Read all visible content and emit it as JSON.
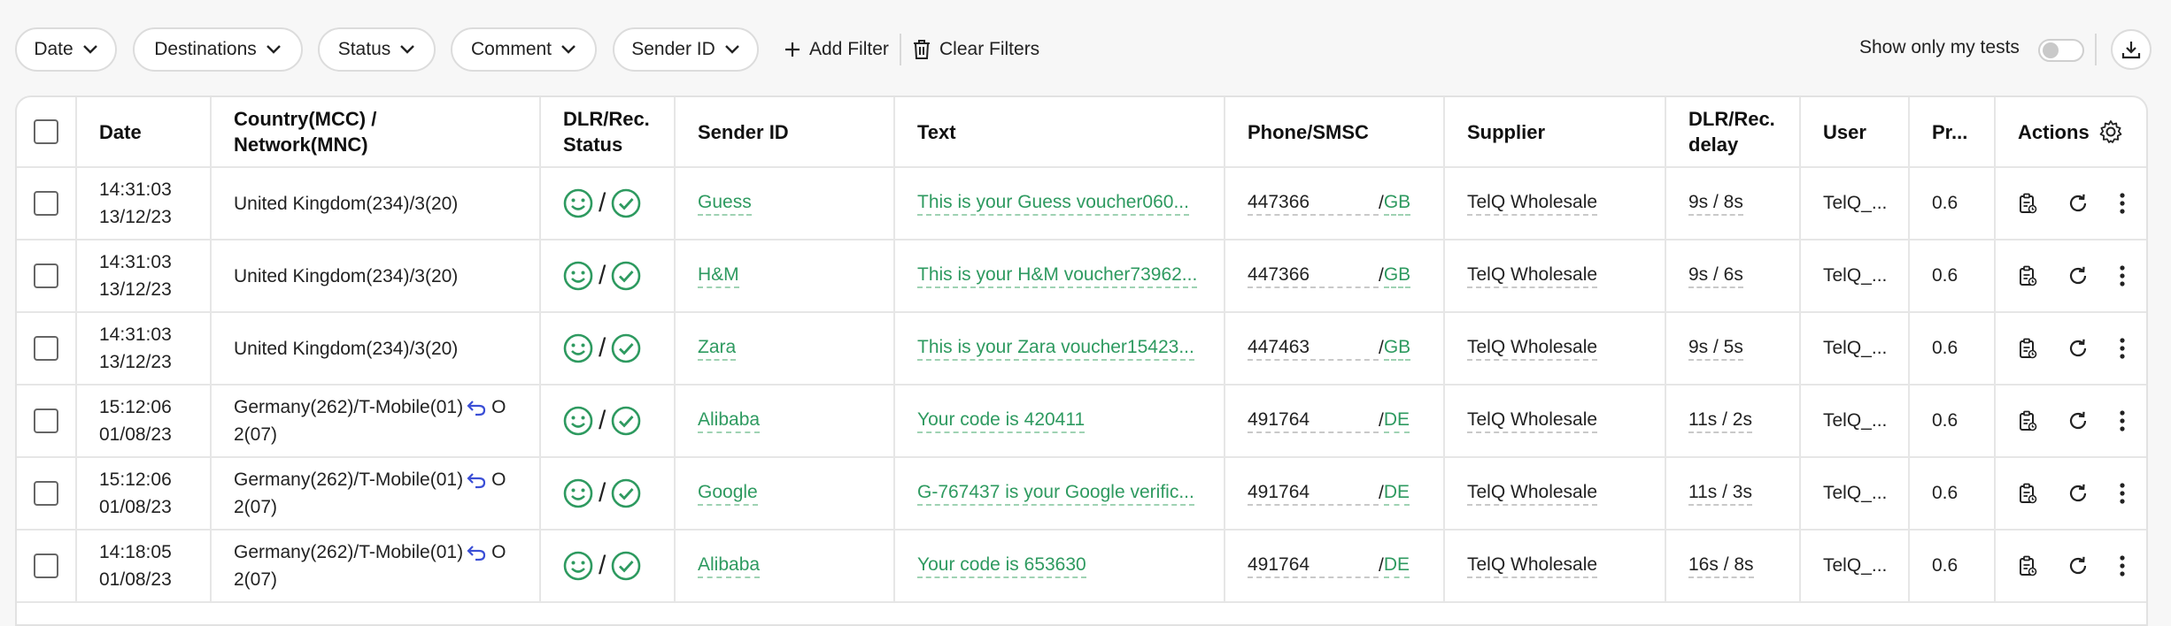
{
  "filters": {
    "pills": [
      {
        "label": "Date"
      },
      {
        "label": "Destinations"
      },
      {
        "label": "Status"
      },
      {
        "label": "Comment"
      },
      {
        "label": "Sender ID"
      }
    ],
    "add_filter": "Add Filter",
    "clear_filters": "Clear Filters",
    "show_only_my_tests": "Show only my tests",
    "show_only_my_tests_on": false
  },
  "table": {
    "headers": {
      "date": "Date",
      "country_line1": "Country(MCC) /",
      "country_line2": "Network(MNC)",
      "status_line1": "DLR/Rec.",
      "status_line2": "Status",
      "sender": "Sender ID",
      "text": "Text",
      "phone": "Phone/SMSC",
      "supplier": "Supplier",
      "delay_line1": "DLR/Rec.",
      "delay_line2": "delay",
      "user": "User",
      "price": "Pr...",
      "actions": "Actions"
    },
    "rows": [
      {
        "time": "14:31:03",
        "date": "13/12/23",
        "country_line1": "United Kingdom(234)/3(20)",
        "country_line2": "",
        "ported": false,
        "sender": "Guess",
        "text": "This is your Guess voucher060...",
        "phone": "447366",
        "cc": "GB",
        "supplier": "TelQ Wholesale",
        "delay": "9s / 8s",
        "user": "TelQ_...",
        "price": "0.6"
      },
      {
        "time": "14:31:03",
        "date": "13/12/23",
        "country_line1": "United Kingdom(234)/3(20)",
        "country_line2": "",
        "ported": false,
        "sender": "H&M",
        "text": "This is your H&M voucher73962...",
        "phone": "447366",
        "cc": "GB",
        "supplier": "TelQ Wholesale",
        "delay": "9s / 6s",
        "user": "TelQ_...",
        "price": "0.6"
      },
      {
        "time": "14:31:03",
        "date": "13/12/23",
        "country_line1": "United Kingdom(234)/3(20)",
        "country_line2": "",
        "ported": false,
        "sender": "Zara",
        "text": "This is your Zara voucher15423...",
        "phone": "447463",
        "cc": "GB",
        "supplier": "TelQ Wholesale",
        "delay": "9s / 5s",
        "user": "TelQ_...",
        "price": "0.6"
      },
      {
        "time": "15:12:06",
        "date": "01/08/23",
        "country_line1": "Germany(262)/T-Mobile(01)",
        "country_line1_tail": "O",
        "country_line2": "2(07)",
        "ported": true,
        "sender": "Alibaba",
        "text": "Your code is 420411",
        "phone": "491764",
        "cc": "DE",
        "supplier": "TelQ Wholesale",
        "delay": "11s / 2s",
        "user": "TelQ_...",
        "price": "0.6"
      },
      {
        "time": "15:12:06",
        "date": "01/08/23",
        "country_line1": "Germany(262)/T-Mobile(01)",
        "country_line1_tail": "O",
        "country_line2": "2(07)",
        "ported": true,
        "sender": "Google",
        "text": "G-767437 is your Google verific...",
        "phone": "491764",
        "cc": "DE",
        "supplier": "TelQ Wholesale",
        "delay": "11s / 3s",
        "user": "TelQ_...",
        "price": "0.6"
      },
      {
        "time": "14:18:05",
        "date": "01/08/23",
        "country_line1": "Germany(262)/T-Mobile(01)",
        "country_line1_tail": "O",
        "country_line2": "2(07)",
        "ported": true,
        "sender": "Alibaba",
        "text": "Your code is 653630",
        "phone": "491764",
        "cc": "DE",
        "supplier": "TelQ Wholesale",
        "delay": "16s / 8s",
        "user": "TelQ_...",
        "price": "0.6"
      }
    ]
  },
  "colors": {
    "accent_green": "#2e9a60",
    "border": "#e6e6e6",
    "ported_icon": "#3b4fd6"
  }
}
